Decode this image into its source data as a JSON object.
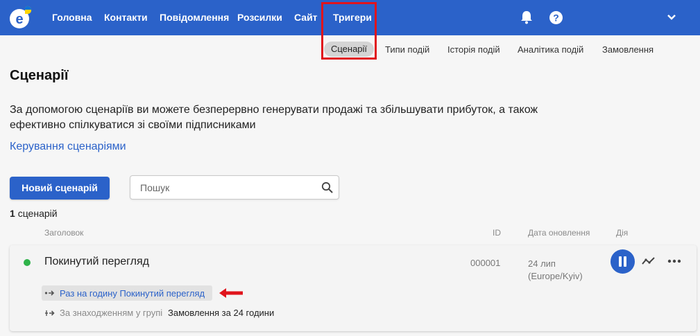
{
  "nav": {
    "items": [
      "Головна",
      "Контакти",
      "Повідомлення",
      "Розсилки",
      "Сайт",
      "Тригери"
    ],
    "icons": [
      "bell-icon",
      "help-icon",
      "chevron-down-icon"
    ],
    "brand_color": "#2b62c9"
  },
  "subnav": {
    "active": "Сценарії",
    "items": [
      "Типи подій",
      "Історія подій",
      "Аналітика подій",
      "Замовлення"
    ]
  },
  "page": {
    "title": "Сценарії",
    "description_line1": "За допомогою сценаріїв ви можете безперервно генерувати продажі та збільшувати прибуток, а також",
    "description_line2": "ефективно спілкуватися зі своїми підписниками",
    "manage_link": "Керування сценаріями"
  },
  "toolbar": {
    "new_button": "Новий сценарій",
    "search_placeholder": "Пошук"
  },
  "list": {
    "count_number": "1",
    "count_label": "сценарій",
    "headers": {
      "title": "Заголовок",
      "id": "ID",
      "updated": "Дата оновлення",
      "action": "Дія"
    },
    "rows": [
      {
        "status": "active",
        "status_color": "#2fb34a",
        "title": "Покинутий перегляд",
        "id": "000001",
        "date": "24 лип",
        "timezone": "(Europe/Kyiv)",
        "trigger_text": "Раз на годину  Покинутий перегляд",
        "condition_label": "За знаходженням у групі",
        "condition_value": "Замовлення за 24 години"
      }
    ]
  },
  "annotation": {
    "highlight_color": "#e0141c"
  }
}
